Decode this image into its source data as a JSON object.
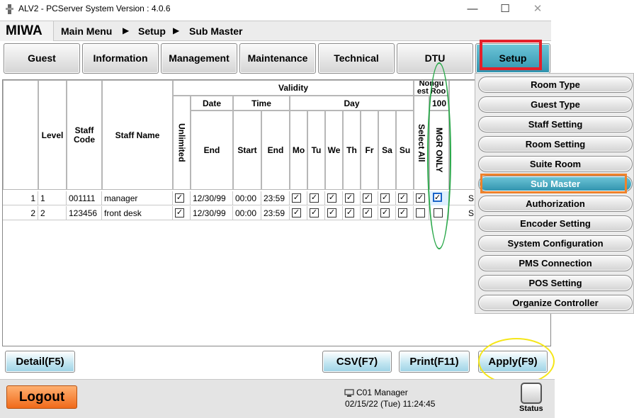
{
  "window": {
    "title": "ALV2 - PCServer System Version : 4.0.6",
    "minimize": "—",
    "maximize": "☐",
    "close": "✕"
  },
  "breadcrumb": {
    "brand": "MIWA",
    "items": [
      "Main Menu",
      "Setup",
      "Sub Master"
    ],
    "arrow": "▶"
  },
  "tabs": [
    {
      "label": "Guest"
    },
    {
      "label": "Information"
    },
    {
      "label": "Management"
    },
    {
      "label": "Maintenance"
    },
    {
      "label": "Technical"
    },
    {
      "label": "DTU"
    },
    {
      "label": "Setup",
      "active": true
    }
  ],
  "table": {
    "headers": {
      "level": "Level",
      "staff_code": "Staff Code",
      "staff_name": "Staff Name",
      "validity": "Validity",
      "unlimited": "Unlimited",
      "date": "Date",
      "time": "Time",
      "day": "Day",
      "end": "End",
      "start": "Start",
      "time_end": "End",
      "days": [
        "Mo",
        "Tu",
        "We",
        "Th",
        "Fr",
        "Sa",
        "Su"
      ],
      "nonguest_room": "Nongu est Roo",
      "room_number": "100",
      "select_all": "Select All",
      "mgr_only": "MGR ONLY"
    },
    "rows": [
      {
        "num": "1",
        "level": "1",
        "code": "001111",
        "name": "manager",
        "unlimited": true,
        "end_date": "12/30/99",
        "start": "00:00",
        "end": "23:59",
        "days": [
          true,
          true,
          true,
          true,
          true,
          true,
          true
        ],
        "select_all": true,
        "mgr_only": true,
        "extra": "S"
      },
      {
        "num": "2",
        "level": "2",
        "code": "123456",
        "name": "front desk",
        "unlimited": true,
        "end_date": "12/30/99",
        "start": "00:00",
        "end": "23:59",
        "days": [
          true,
          true,
          true,
          true,
          true,
          true,
          true
        ],
        "select_all": false,
        "mgr_only": false,
        "extra": "S"
      }
    ]
  },
  "setup_menu": {
    "items": [
      "Room Type",
      "Guest Type",
      "Staff Setting",
      "Room Setting",
      "Suite Room",
      "Sub Master",
      "Authorization",
      "Encoder Setting",
      "System Configuration",
      "PMS Connection",
      "POS Setting",
      "Organize Controller"
    ],
    "active_index": 5
  },
  "buttons": {
    "detail": "Detail(F5)",
    "csv": "CSV(F7)",
    "print": "Print(F11)",
    "apply": "Apply(F9)"
  },
  "footer": {
    "logout": "Logout",
    "user": "C01 Manager",
    "datetime": "02/15/22 (Tue) 11:24:45",
    "status": "Status"
  },
  "colors": {
    "active_tab": "#2f92ad",
    "setup_highlight": "#e4202a",
    "submaster_highlight": "#f0822a",
    "ellipse_green": "#2aa84a",
    "ellipse_yellow": "#f5e619",
    "logout": "#f06a1a"
  }
}
